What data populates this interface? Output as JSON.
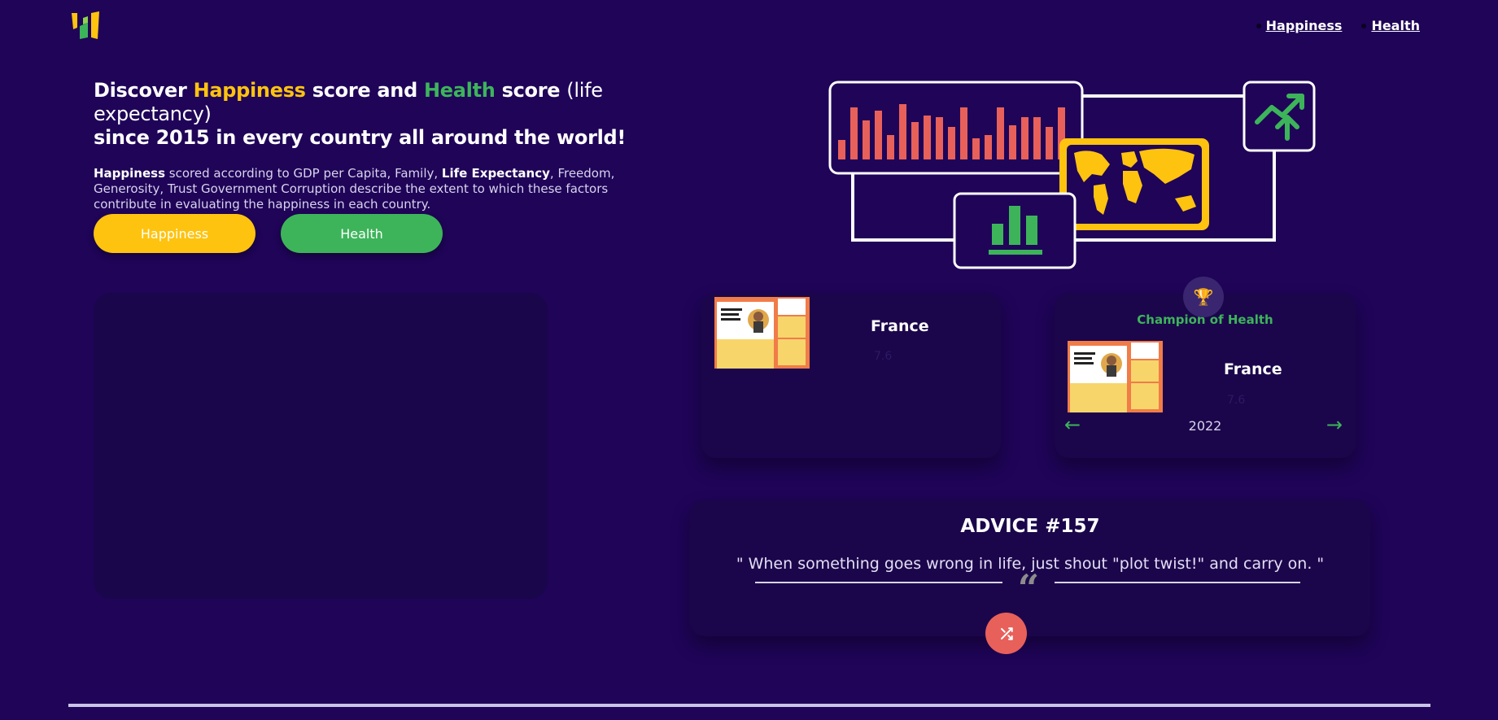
{
  "header": {
    "nav": [
      {
        "label": "Happiness"
      },
      {
        "label": "Health"
      }
    ]
  },
  "hero": {
    "title_p1": "Discover ",
    "title_hap": "Happiness",
    "title_p2": " score and ",
    "title_hea": "Health",
    "title_p3": " score ",
    "title_light": "(life expectancy)",
    "title_line2": "since 2015 in every country all around the world!",
    "desc_b1": "Happiness",
    "desc_p1": " scored according to GDP per Capita, Family, ",
    "desc_b2": "Life Expectancy",
    "desc_p2": ", Freedom, Generosity, Trust Government Corruption describe the extent to which these factors contribute in evaluating the happiness in each country."
  },
  "buttons": {
    "happiness": "Happiness",
    "health": "Health"
  },
  "card_happiness": {
    "country": "France",
    "score": "7.6"
  },
  "card_health": {
    "title": "Champion of Health",
    "country": "France",
    "score": "7.6",
    "year": "2022",
    "prev_icon": "arrow-left-icon",
    "next_icon": "arrow-right-icon"
  },
  "advice": {
    "title": "ADVICE #157",
    "text": "\" When something goes wrong in life, just shout \"plot twist!\" and carry on. \""
  },
  "colors": {
    "background": "#1f0458",
    "happiness": "#fec30f",
    "health": "#3db45a",
    "accent_red": "#e8605a",
    "card": "#1b064b"
  },
  "icons": [
    "logo-icon",
    "trophy-icon",
    "quote-icon",
    "shuffle-icon",
    "arrow-left-icon",
    "arrow-right-icon"
  ]
}
